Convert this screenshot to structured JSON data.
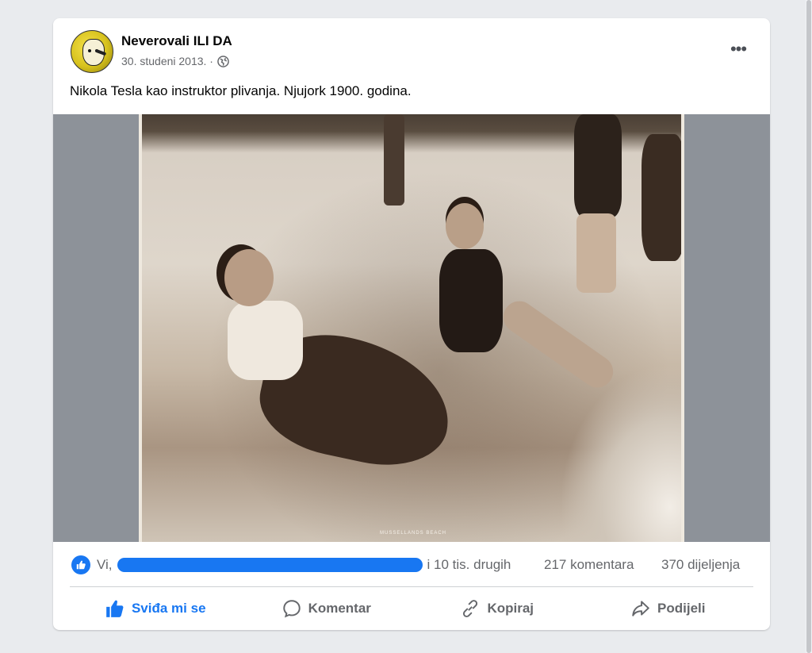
{
  "post": {
    "page_name": "Neverovali ILI DA",
    "date": "30. studeni 2013. ·",
    "privacy_icon": "globe-icon",
    "more_icon": "•••",
    "text": "Nikola Tesla kao instruktor plivanja. Njujork 1900. godina."
  },
  "photo": {
    "caption": "MUSSELLANDS BEACH"
  },
  "stats": {
    "reactions_prefix": "Vi,",
    "reactions_suffix": "i 10 tis. drugih",
    "comments": "217 komentara",
    "shares": "370 dijeljenja"
  },
  "actions": {
    "like": "Sviđa mi se",
    "comment": "Komentar",
    "copy": "Kopiraj",
    "share": "Podijeli"
  },
  "colors": {
    "accent": "#1877f2",
    "secondary_text": "#65676b"
  }
}
